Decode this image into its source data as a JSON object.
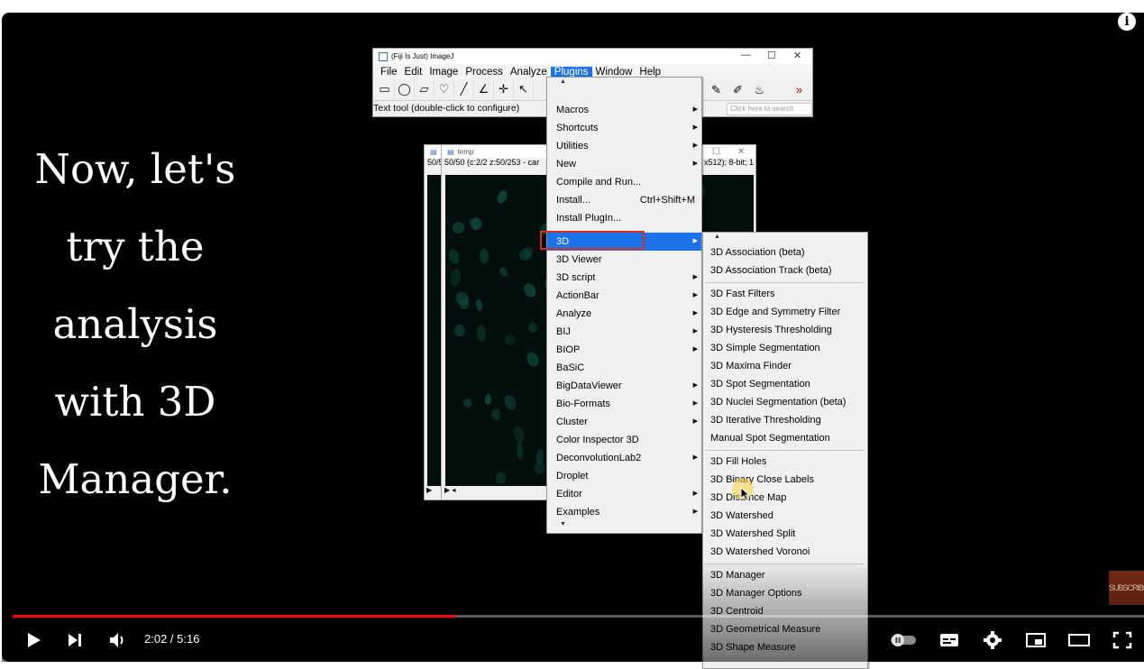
{
  "caption": {
    "lines": [
      "Now, let's",
      "try the",
      "analysis",
      "with 3D",
      "Manager."
    ]
  },
  "imagej": {
    "title": "(Fiji Is Just) ImageJ",
    "menubar": [
      "File",
      "Edit",
      "Image",
      "Process",
      "Analyze",
      "Plugins",
      "Window",
      "Help"
    ],
    "active_menu": "Plugins",
    "status": "Text tool (double-click to configure)",
    "search_placeholder": "Click here to search"
  },
  "image_windows": {
    "back_title": "",
    "back_sub": "50/5",
    "front_title": "temp",
    "front_sub": "50/50 (c:2/2 z:50/253 - car",
    "right_sub": "x512); 8-bit; 1"
  },
  "plugins_menu": {
    "items": [
      {
        "label": "Macros",
        "submenu": true
      },
      {
        "label": "Shortcuts",
        "submenu": true
      },
      {
        "label": "Utilities",
        "submenu": true
      },
      {
        "label": "New",
        "submenu": true
      },
      {
        "label": "Compile and Run...",
        "submenu": false
      },
      {
        "label": "Install...",
        "submenu": false,
        "shortcut": "Ctrl+Shift+M"
      },
      {
        "label": "Install PlugIn...",
        "submenu": false
      },
      {
        "label": "3D",
        "submenu": true,
        "highlighted": true
      },
      {
        "label": "3D Viewer",
        "submenu": false
      },
      {
        "label": "3D script",
        "submenu": true
      },
      {
        "label": "ActionBar",
        "submenu": true
      },
      {
        "label": "Analyze",
        "submenu": true
      },
      {
        "label": "BIJ",
        "submenu": true
      },
      {
        "label": "BIOP",
        "submenu": true
      },
      {
        "label": "BaSiC",
        "submenu": false
      },
      {
        "label": "BigDataViewer",
        "submenu": true
      },
      {
        "label": "Bio-Formats",
        "submenu": true
      },
      {
        "label": "Cluster",
        "submenu": true
      },
      {
        "label": "Color Inspector 3D",
        "submenu": false
      },
      {
        "label": "DeconvolutionLab2",
        "submenu": true
      },
      {
        "label": "Droplet",
        "submenu": false
      },
      {
        "label": "Editor",
        "submenu": true
      },
      {
        "label": "Examples",
        "submenu": true
      }
    ]
  },
  "submenu_3d": {
    "groups": [
      [
        "3D Association (beta)",
        "3D Association Track (beta)"
      ],
      [
        "3D Fast Filters",
        "3D Edge and Symmetry Filter",
        "3D Hysteresis Thresholding",
        "3D Simple Segmentation",
        "3D Maxima Finder",
        "3D Spot Segmentation",
        "3D Nuclei Segmentation (beta)",
        "3D Iterative Thresholding",
        "Manual Spot Segmentation"
      ],
      [
        "3D Fill Holes",
        "3D Binary Close Labels",
        "3D Distance Map",
        "3D Watershed",
        "3D Watershed Split",
        "3D Watershed Voronoi"
      ],
      [
        "3D Manager",
        "3D Manager Options",
        "3D Centroid",
        "3D Geometrical Measure",
        "3D Shape Measure"
      ]
    ]
  },
  "subscribe_badge": "SUBSCRIBE",
  "player": {
    "time_display": "2:02 / 5:16",
    "progress_fraction": 0.3909,
    "accent": "#ff0000"
  }
}
